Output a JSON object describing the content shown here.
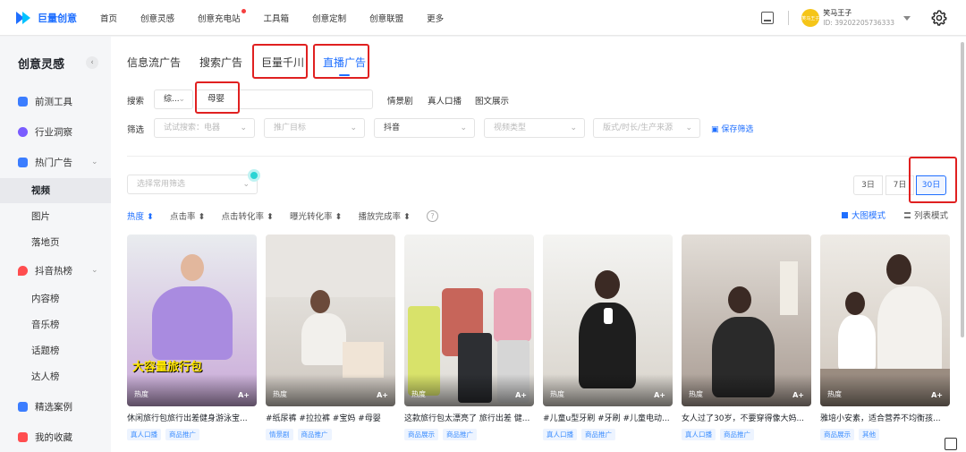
{
  "app": {
    "logo_text": "巨量创意"
  },
  "nav": [
    "首页",
    "创意灵感",
    "创意充电站",
    "工具箱",
    "创意定制",
    "创意联盟",
    "更多"
  ],
  "user": {
    "name": "笑马王子",
    "id": "ID: 39202205736333",
    "avatar_text": "笑马王子"
  },
  "sidebar": {
    "title": "创意灵感",
    "collapse_icon": "‹",
    "items": [
      {
        "label": "前测工具",
        "icon": "test-icon",
        "color": "#3b7dff"
      },
      {
        "label": "行业洞察",
        "icon": "insight-icon",
        "color": "#7a5cff"
      },
      {
        "label": "热门广告",
        "icon": "ad-icon",
        "color": "#3b7dff"
      },
      {
        "label": "抖音热榜",
        "icon": "fire-icon",
        "color": "#ff4d4f"
      },
      {
        "label": "精选案例",
        "icon": "case-icon",
        "color": "#3b7dff"
      },
      {
        "label": "我的收藏",
        "icon": "collect-icon",
        "color": "#ff4d4f"
      }
    ],
    "sub_ads": [
      "视频",
      "图片",
      "落地页"
    ],
    "sub_douyin": [
      "内容榜",
      "音乐榜",
      "话题榜",
      "达人榜"
    ]
  },
  "tabs": [
    "信息流广告",
    "搜索广告",
    "巨量千川",
    "直播广告"
  ],
  "search": {
    "label": "搜索",
    "type": "综...",
    "value": "母婴",
    "chips": [
      "情景剧",
      "真人口播",
      "图文展示"
    ]
  },
  "filter": {
    "label": "筛选",
    "placeholder1": "试试搜索：电器",
    "placeholder2": "推广目标",
    "platform": "抖音",
    "placeholder3": "视频类型",
    "placeholder4": "版式/时长/生产来源",
    "save": "保存筛选"
  },
  "common_filter": "选择常用筛选",
  "days": [
    "3日",
    "7日",
    "30日"
  ],
  "sorts": [
    "热度",
    "点击率",
    "点击转化率",
    "曝光转化率",
    "播放完成率"
  ],
  "view": {
    "grid": "大图模式",
    "list": "列表模式"
  },
  "cards": [
    {
      "title": "休闲旅行包旅行出差健身游泳宝...",
      "tags": [
        "真人口播",
        "商品推广"
      ],
      "hot": "热度",
      "level": "A+",
      "caption": "大容量旅行包",
      "bg": "#e5b6d2"
    },
    {
      "title": "#纸尿裤 #拉拉裤 #宝妈 #母婴",
      "tags": [
        "情景剧",
        "商品推广"
      ],
      "hot": "热度",
      "level": "A+",
      "caption": "",
      "bg": "#d8d4cf"
    },
    {
      "title": "这款旅行包太漂亮了 旅行出差 健...",
      "tags": [
        "商品展示",
        "商品推广"
      ],
      "hot": "热度",
      "level": "A+",
      "caption": "",
      "bg": "#cfd6cc"
    },
    {
      "title": "#儿童u型牙刷 #牙刷 #儿童电动...",
      "tags": [
        "真人口播",
        "商品推广"
      ],
      "hot": "热度",
      "level": "A+",
      "caption": "",
      "bg": "#d9d6d0"
    },
    {
      "title": "女人过了30岁，不要穿得像大妈...",
      "tags": [
        "真人口播",
        "商品推广"
      ],
      "hot": "热度",
      "level": "A+",
      "caption": "",
      "bg": "#cbbfb6"
    },
    {
      "title": "雅培小安素，适合营养不均衡孩...",
      "tags": [
        "商品展示",
        "其他"
      ],
      "hot": "热度",
      "level": "A+",
      "caption": "",
      "bg": "#ddd9d2"
    }
  ]
}
